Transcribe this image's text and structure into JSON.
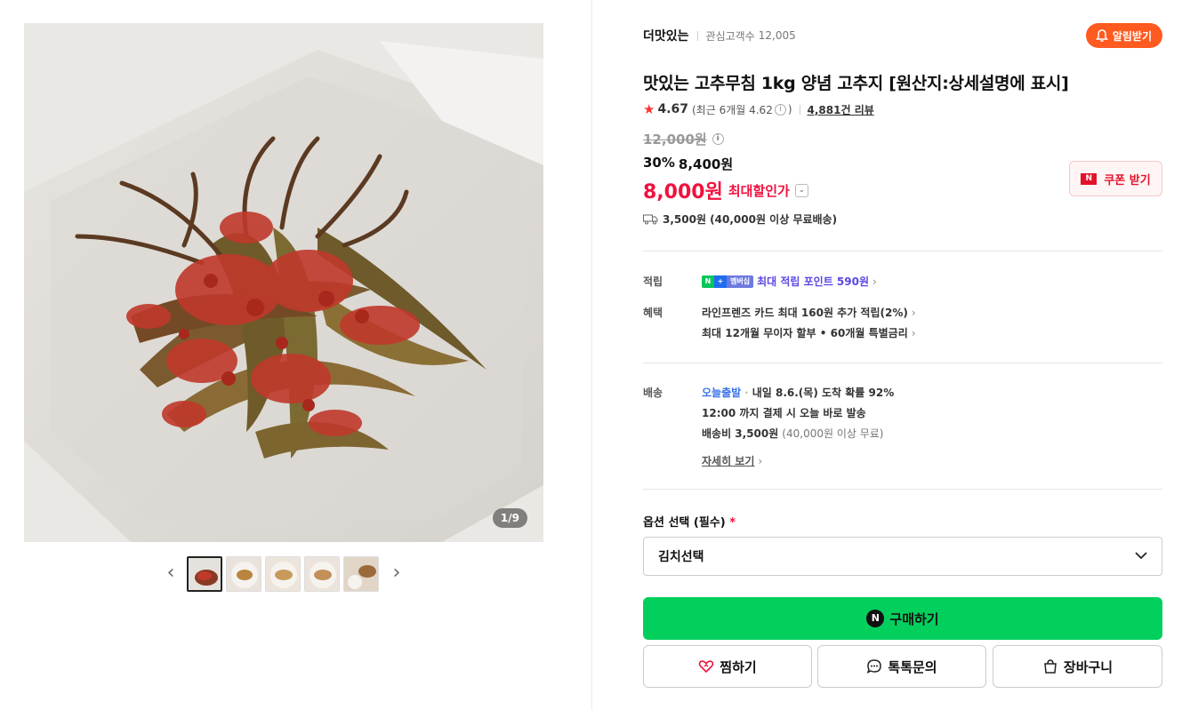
{
  "gallery": {
    "page_indicator": "1/9",
    "thumb_count": 5,
    "prev_glyph": "‹",
    "next_glyph": "›"
  },
  "store": {
    "name": "더맛있는",
    "fans_label": "관심고객수",
    "fans_count": "12,005",
    "alarm_label": "알림받기"
  },
  "product": {
    "title": "맛있는 고추무침 1kg 양념 고추지 [원산지:상세설명에 표시]",
    "rating": "4.67",
    "rating_recent": "(최근 6개월 4.62",
    "rating_recent_close": ")",
    "review_count": "4,881건 리뷰",
    "original_price": "12,000원",
    "discount_pct": "30%",
    "discount_price": "8,400원",
    "max_price": "8,000원",
    "max_label": "최대할인가",
    "coupon_label": "쿠폰 받기",
    "shipping": "3,500원 (40,000원 이상 무료배송)"
  },
  "benefits": {
    "points_label": "적립",
    "points_badge": "멤버십",
    "points_text": "최대 적립 포인트 590원",
    "perks_label": "혜택",
    "perk1": "라인프렌즈 카드 최대 160원 추가 적립(2%)",
    "perk2": "최대 12개월 무이자 할부 • 60개월 특별금리"
  },
  "delivery": {
    "label": "배송",
    "today": "오늘출발",
    "arrival": "내일 8.6.(목) 도착 확률 92%",
    "cutoff": "12:00 까지 결제 시 오늘 바로 발송",
    "fee": "배송비 3,500원",
    "fee_note": "(40,000원 이상 무료)",
    "detail": "자세히 보기"
  },
  "option": {
    "label": "옵션 선택 (필수)",
    "required_mark": "*",
    "selected": "김치선택"
  },
  "actions": {
    "buy": "구매하기",
    "wish": "찜하기",
    "talk": "톡톡문의",
    "cart": "장바구니"
  },
  "colors": {
    "brand_green": "#03cf5d",
    "price_red": "#f0113e",
    "alarm_orange": "#ff5a1f",
    "points_purple": "#5a48e5",
    "today_blue": "#3a74e8"
  }
}
